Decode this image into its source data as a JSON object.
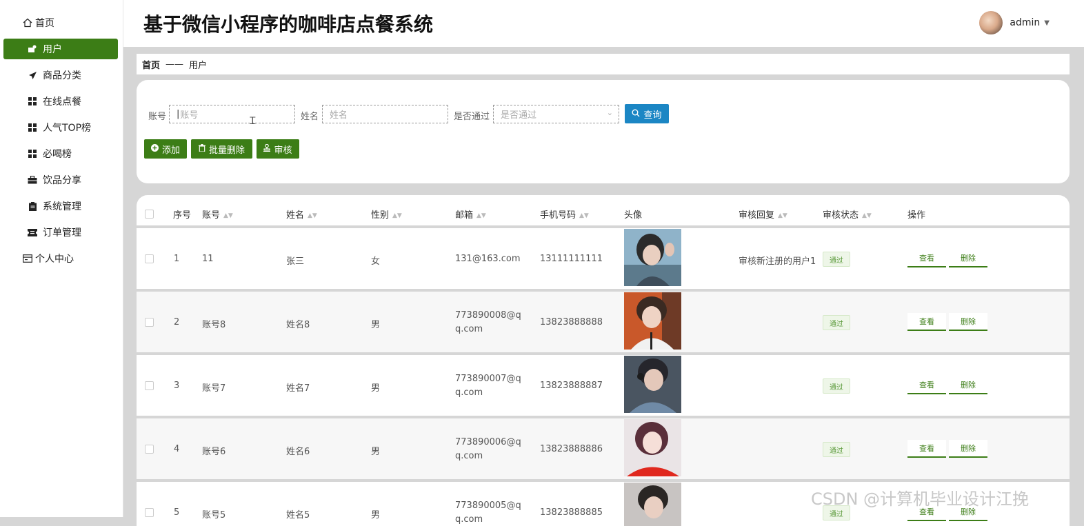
{
  "app": {
    "title": "基于微信小程序的咖啡店点餐系统",
    "user_name": "admin"
  },
  "sidebar": {
    "items": [
      {
        "label": "首页",
        "icon": "home-icon"
      },
      {
        "label": "用户",
        "icon": "user-icon",
        "active": true
      },
      {
        "label": "商品分类",
        "icon": "send-icon"
      },
      {
        "label": "在线点餐",
        "icon": "grid-icon"
      },
      {
        "label": "人气TOP榜",
        "icon": "grid-icon"
      },
      {
        "label": "必喝榜",
        "icon": "grid-icon"
      },
      {
        "label": "饮品分享",
        "icon": "briefcase-icon"
      },
      {
        "label": "系统管理",
        "icon": "clipboard-icon"
      },
      {
        "label": "订单管理",
        "icon": "ticket-icon"
      },
      {
        "label": "个人中心",
        "icon": "card-icon"
      }
    ]
  },
  "breadcrumb": {
    "home": "首页",
    "separator": "——",
    "current": "用户"
  },
  "search": {
    "account_label": "账号",
    "account_placeholder": "账号",
    "name_label": "姓名",
    "name_placeholder": "姓名",
    "approved_label": "是否通过",
    "approved_placeholder": "是否通过",
    "query_button": "查询"
  },
  "actions": {
    "add": "添加",
    "batch_delete": "批量删除",
    "review": "审核"
  },
  "table": {
    "columns": [
      "序号",
      "账号",
      "姓名",
      "性别",
      "邮箱",
      "手机号码",
      "头像",
      "审核回复",
      "审核状态",
      "操作"
    ],
    "rows": [
      {
        "no": "1",
        "account": "11",
        "name": "张三",
        "gender": "女",
        "email": "131@163.com",
        "phone": "13111111111",
        "reply": "审核新注册的用户1",
        "status": "通过",
        "view": "查看",
        "delete": "删除"
      },
      {
        "no": "2",
        "account": "账号8",
        "name": "姓名8",
        "gender": "男",
        "email": "773890008@qq.com",
        "phone": "13823888888",
        "reply": "",
        "status": "通过",
        "view": "查看",
        "delete": "删除"
      },
      {
        "no": "3",
        "account": "账号7",
        "name": "姓名7",
        "gender": "男",
        "email": "773890007@qq.com",
        "phone": "13823888887",
        "reply": "",
        "status": "通过",
        "view": "查看",
        "delete": "删除"
      },
      {
        "no": "4",
        "account": "账号6",
        "name": "姓名6",
        "gender": "男",
        "email": "773890006@qq.com",
        "phone": "13823888886",
        "reply": "",
        "status": "通过",
        "view": "查看",
        "delete": "删除"
      },
      {
        "no": "5",
        "account": "账号5",
        "name": "姓名5",
        "gender": "男",
        "email": "773890005@qq.com",
        "phone": "13823888885",
        "reply": "",
        "status": "通过",
        "view": "查看",
        "delete": "删除"
      }
    ]
  },
  "watermark": "CSDN @计算机毕业设计江挽",
  "colors": {
    "accent_green": "#3c7d16",
    "query_blue": "#1b86c4",
    "page_background": "#d6d6d6"
  }
}
